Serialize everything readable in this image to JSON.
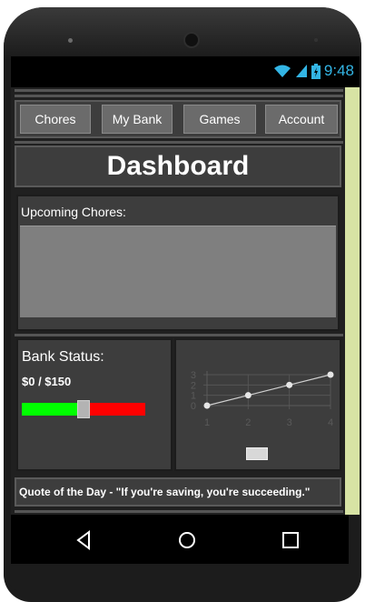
{
  "status": {
    "time": "9:48"
  },
  "nav": {
    "buttons": [
      "Chores",
      "My Bank",
      "Games",
      "Account"
    ]
  },
  "page": {
    "title": "Dashboard"
  },
  "chores": {
    "label": "Upcoming Chores:"
  },
  "bank": {
    "title": "Bank Status:",
    "amount": "$0 / $150",
    "progress_fraction": 0.5,
    "colors": {
      "saved": "#00ff00",
      "remaining": "#ff0000"
    }
  },
  "chart_data": {
    "type": "line",
    "x": [
      1,
      2,
      3,
      4
    ],
    "y": [
      0,
      1,
      2,
      3
    ],
    "x_ticks": [
      "1",
      "2",
      "3",
      "4"
    ],
    "y_ticks": [
      "0",
      "1",
      "2",
      "3"
    ],
    "xlim": [
      1,
      4
    ],
    "ylim": [
      0,
      3
    ],
    "grid": true
  },
  "quote": {
    "text": "Quote of the Day - \"If you're saving, you're succeeding.\""
  },
  "colors": {
    "accent": "#33b5e5",
    "sidebar": "#d7e3a4",
    "panel": "#3d3d3d"
  },
  "icons": {
    "back": "back-triangle-icon",
    "home": "home-circle-icon",
    "recents": "recents-square-icon"
  }
}
